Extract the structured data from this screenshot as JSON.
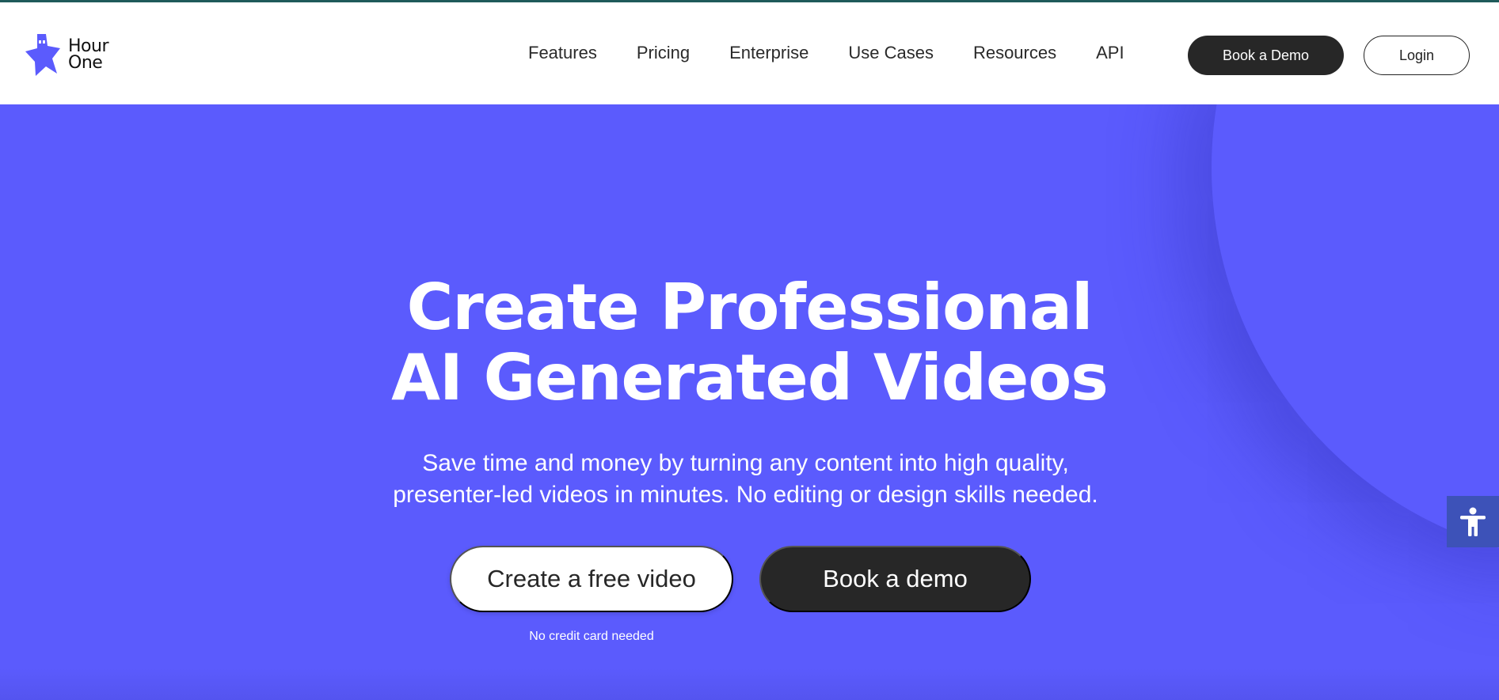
{
  "brand": {
    "name_line1": "Hour",
    "name_line2": "One",
    "accent_color": "#5b5bfd"
  },
  "nav": {
    "items": [
      {
        "label": "Features"
      },
      {
        "label": "Pricing"
      },
      {
        "label": "Enterprise"
      },
      {
        "label": "Use Cases"
      },
      {
        "label": "Resources"
      },
      {
        "label": "API"
      }
    ],
    "book_demo_label": "Book a Demo",
    "login_label": "Login"
  },
  "hero": {
    "title_line1": "Create Professional",
    "title_line2": "AI Generated Videos",
    "subtitle_line1": "Save time and money by turning any content into high quality,",
    "subtitle_line2": "presenter-led videos in minutes. No editing or design skills needed.",
    "primary_cta": "Create a free video",
    "secondary_cta": "Book a demo",
    "note": "No credit card needed",
    "background_color": "#5b5bfd"
  },
  "accessibility": {
    "icon": "accessibility-icon"
  }
}
